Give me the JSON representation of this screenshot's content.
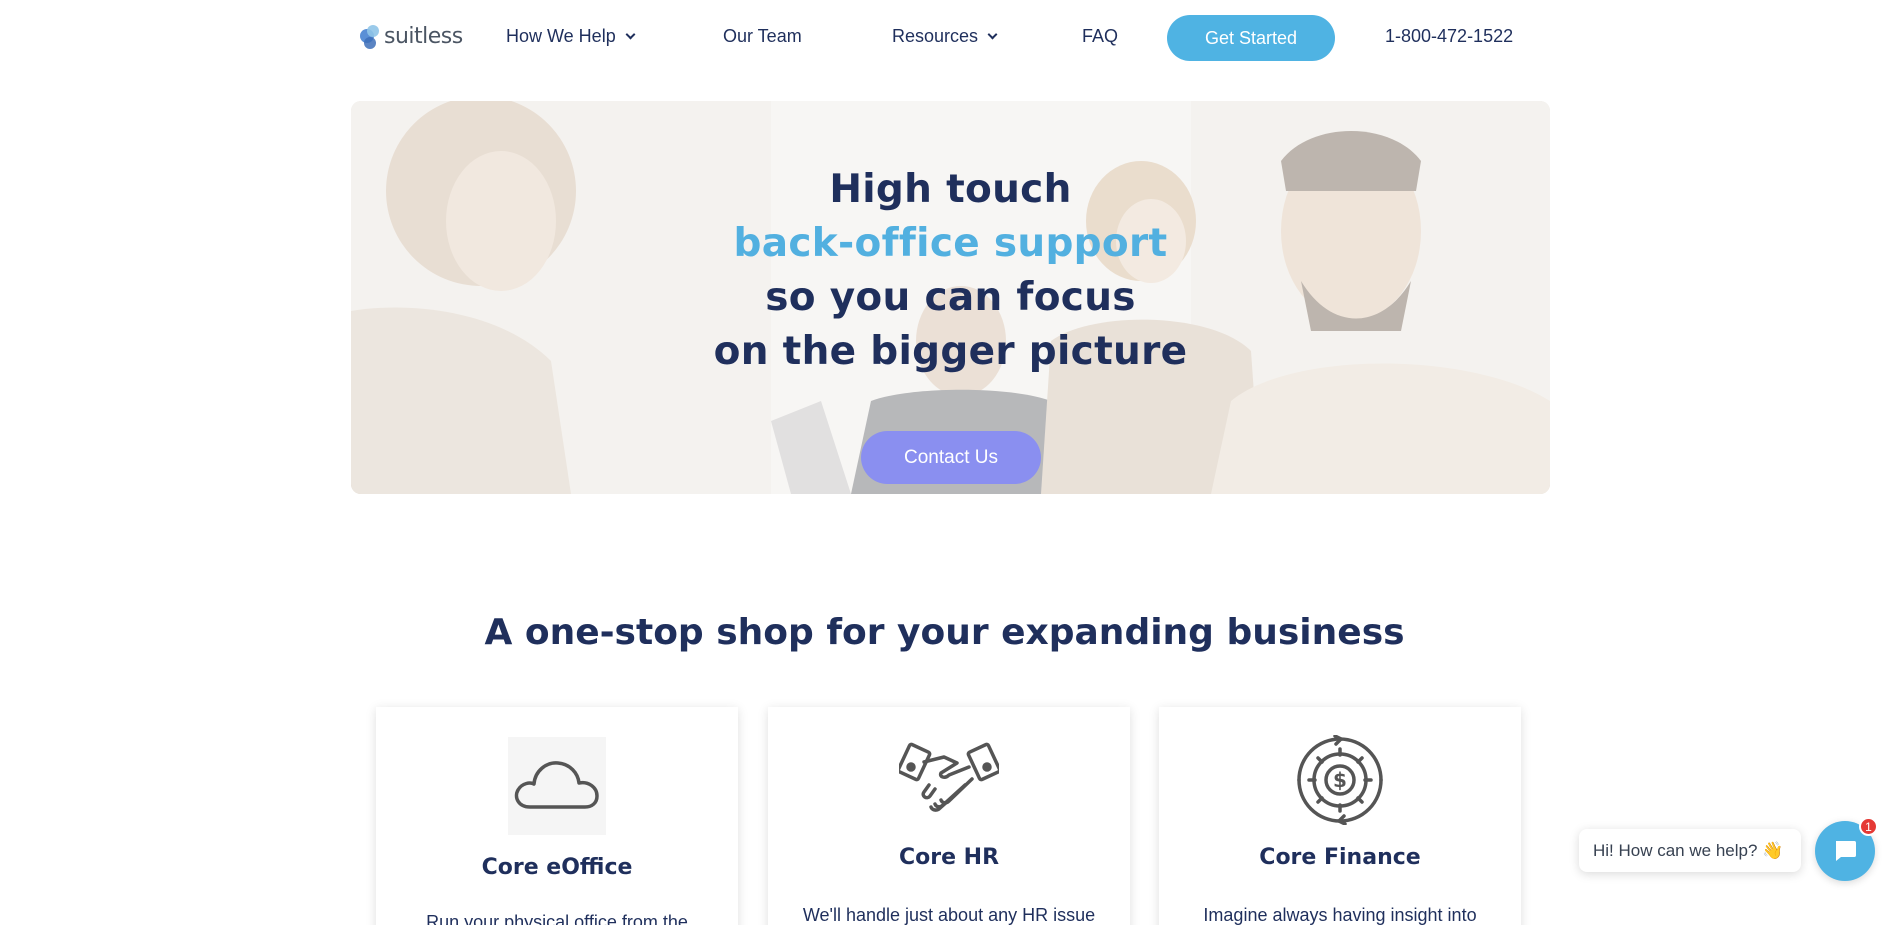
{
  "brand": {
    "logo_text": "suitless"
  },
  "nav": {
    "how_we_help": "How We Help",
    "our_team": "Our Team",
    "resources": "Resources",
    "faq": "FAQ",
    "get_started": "Get Started",
    "phone": "1-800-472-1522"
  },
  "hero": {
    "line1": "High touch",
    "line2": "back-office support",
    "line3": "so you can focus",
    "line4": "on the bigger picture",
    "cta": "Contact Us"
  },
  "section": {
    "title": "A one-stop shop for your expanding business",
    "cards": [
      {
        "icon": "cloud-icon",
        "title": "Core eOffice",
        "text": "Run your physical office from the"
      },
      {
        "icon": "handshake-icon",
        "title": "Core HR",
        "text": "We'll handle just about any HR issue"
      },
      {
        "icon": "gear-dollar-icon",
        "title": "Core Finance",
        "text": "Imagine always having insight into"
      }
    ]
  },
  "chat": {
    "prompt": "Hi! How can we help? 👋",
    "badge_count": "1"
  },
  "colors": {
    "navy": "#1f2f5c",
    "accent_blue": "#4fb3e3",
    "contact_purple": "#8a8ff0",
    "badge_red": "#e53935"
  }
}
